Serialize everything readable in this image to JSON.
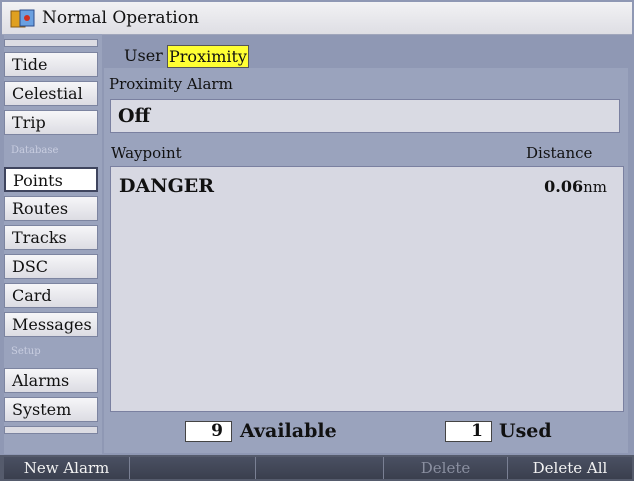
{
  "titlebar": {
    "title": "Normal Operation",
    "icon": "chart-plotter-icon"
  },
  "sidebar": {
    "items": [
      {
        "label": "Tide"
      },
      {
        "label": "Celestial"
      },
      {
        "label": "Trip"
      },
      {
        "label": "Points",
        "active": true
      },
      {
        "label": "Routes"
      },
      {
        "label": "Tracks"
      },
      {
        "label": "DSC"
      },
      {
        "label": "Card"
      },
      {
        "label": "Messages"
      },
      {
        "label": "Alarms"
      },
      {
        "label": "System"
      }
    ],
    "sections": {
      "database": "Database",
      "setup": "Setup"
    }
  },
  "tabs": {
    "user": "User",
    "proximity": "Proximity",
    "selected": "Proximity"
  },
  "proximity_alarm": {
    "label": "Proximity Alarm",
    "value": "Off"
  },
  "waypoint_list": {
    "columns": {
      "waypoint": "Waypoint",
      "distance": "Distance"
    },
    "rows": [
      {
        "name": "DANGER",
        "distance": "0.06",
        "unit": "nm"
      }
    ]
  },
  "counts": {
    "available": "9",
    "available_label": "Available",
    "used": "1",
    "used_label": "Used"
  },
  "softkeys": [
    {
      "label": "New Alarm",
      "enabled": true
    },
    {
      "label": "",
      "enabled": true
    },
    {
      "label": "",
      "enabled": true
    },
    {
      "label": "Delete",
      "enabled": false
    },
    {
      "label": "Delete All",
      "enabled": true
    }
  ],
  "colors": {
    "tab_highlight": "#ffff33",
    "panel": "#9aa3bd",
    "list_bg": "#d7d8e2"
  }
}
